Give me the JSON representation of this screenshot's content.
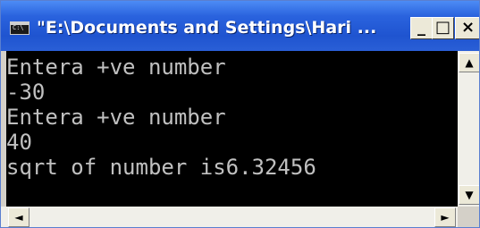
{
  "window": {
    "title": "\"E:\\Documents and Settings\\Hari ...",
    "system_icon_text": "C:\\",
    "minimize_glyph": "_",
    "maximize_glyph": "□",
    "close_glyph": "×"
  },
  "console": {
    "lines": [
      "Entera +ve number",
      "-30",
      "Entera +ve number",
      "40",
      "sqrt of number is6.32456"
    ]
  },
  "scrollbars": {
    "up_glyph": "▲",
    "down_glyph": "▼",
    "left_glyph": "◄",
    "right_glyph": "►"
  },
  "colors": {
    "title_bar": "#2a63de",
    "console_bg": "#000000",
    "console_text": "#c0c0c0"
  }
}
